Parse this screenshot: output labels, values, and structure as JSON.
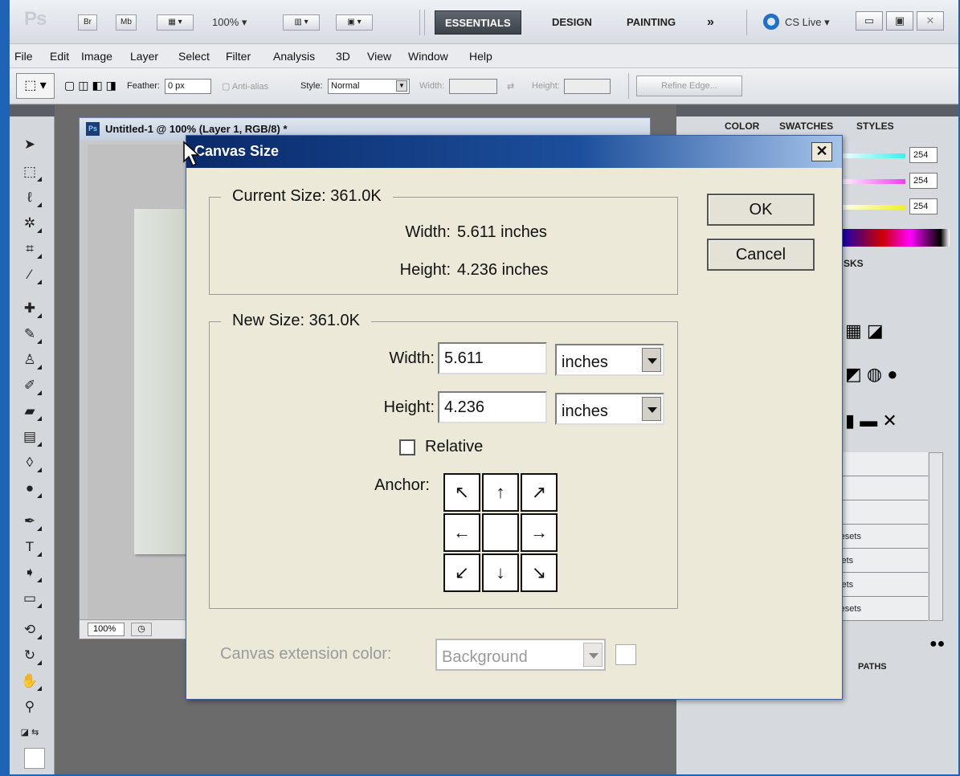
{
  "appbar": {
    "logo": "Ps",
    "br": "Br",
    "mb": "Mb",
    "zoom": "100%",
    "workspaces": [
      "ESSENTIALS",
      "DESIGN",
      "PAINTING"
    ],
    "more": "»",
    "cslive": "CS Live"
  },
  "menu": [
    "File",
    "Edit",
    "Image",
    "Layer",
    "Select",
    "Filter",
    "Analysis",
    "3D",
    "View",
    "Window",
    "Help"
  ],
  "options": {
    "feather_label": "Feather:",
    "feather_value": "0 px",
    "antialias_label": "Anti-alias",
    "style_label": "Style:",
    "style_value": "Normal",
    "width_label": "Width:",
    "height_label": "Height:",
    "refine_edge": "Refine Edge..."
  },
  "document": {
    "title": "Untitled-1 @ 100% (Layer 1, RGB/8) *",
    "zoom": "100%"
  },
  "panels": {
    "tabs": [
      "COLOR",
      "SWATCHES",
      "STYLES"
    ],
    "slider_values": [
      "254",
      "254",
      "254"
    ],
    "masks_tab": "SKS",
    "paths_tab": "PATHS",
    "preset_rows": [
      "resets",
      "sets",
      "sets",
      "resets"
    ]
  },
  "dialog": {
    "title": "Canvas Size",
    "current_legend": "Current Size: 361.0K",
    "current_width_label": "Width:",
    "current_width_value": "5.611 inches",
    "current_height_label": "Height:",
    "current_height_value": "4.236 inches",
    "new_legend": "New Size: 361.0K",
    "width_label": "Width:",
    "width_value": "5.611",
    "width_unit": "inches",
    "height_label": "Height:",
    "height_value": "4.236",
    "height_unit": "inches",
    "relative_label": "Relative",
    "anchor_label": "Anchor:",
    "ext_label": "Canvas extension color:",
    "ext_value": "Background",
    "ok": "OK",
    "cancel": "Cancel"
  },
  "colors": {
    "title_gradient_start": "#0a2a6a",
    "title_gradient_end": "#a6c4ea",
    "dialog_bg": "#ece9d8"
  }
}
